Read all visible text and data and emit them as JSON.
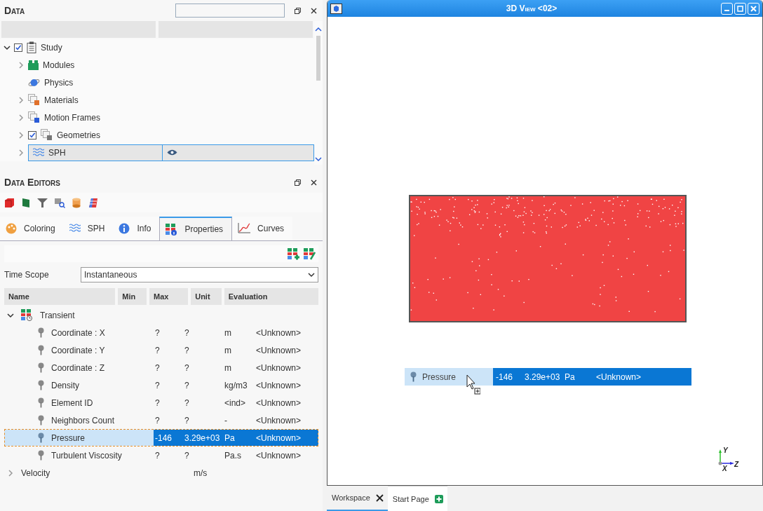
{
  "data_panel": {
    "title": "Data",
    "tree": [
      {
        "label": "Study",
        "kind": "study",
        "expanded": true,
        "checked": true,
        "selected": false,
        "children": [
          {
            "label": "Modules",
            "kind": "modules",
            "expanded": false,
            "selected": false
          },
          {
            "label": "Physics",
            "kind": "physics",
            "selected": false
          },
          {
            "label": "Materials",
            "kind": "materials",
            "expanded": false,
            "selected": false
          },
          {
            "label": "Motion Frames",
            "kind": "frames",
            "expanded": false,
            "selected": false
          },
          {
            "label": "Geometries",
            "kind": "geometries",
            "expanded": false,
            "checked": true,
            "selected": false
          },
          {
            "label": "SPH",
            "kind": "sph",
            "expanded": false,
            "selected": true,
            "visible": true
          }
        ]
      }
    ]
  },
  "editors_panel": {
    "title": "Data Editors",
    "tabs": [
      {
        "label": "Coloring",
        "kind": "coloring",
        "selected": false
      },
      {
        "label": "SPH",
        "kind": "sph",
        "selected": false
      },
      {
        "label": "Info",
        "kind": "info",
        "selected": false
      },
      {
        "label": "Properties",
        "kind": "properties",
        "selected": true
      },
      {
        "label": "Curves",
        "kind": "curves",
        "selected": false
      }
    ],
    "time_scope": {
      "label": "Time Scope",
      "value": "Instantaneous"
    },
    "table": {
      "columns": [
        "Name",
        "Min",
        "Max",
        "Unit",
        "Evaluation"
      ],
      "rows": [
        {
          "name": "Transient",
          "kind": "group",
          "expanded": true,
          "children": [
            {
              "name": "Coordinate : X",
              "min": "?",
              "max": "?",
              "unit": "m",
              "evaluation": "<Unknown>",
              "selected": false
            },
            {
              "name": "Coordinate : Y",
              "min": "?",
              "max": "?",
              "unit": "m",
              "evaluation": "<Unknown>",
              "selected": false
            },
            {
              "name": "Coordinate : Z",
              "min": "?",
              "max": "?",
              "unit": "m",
              "evaluation": "<Unknown>",
              "selected": false
            },
            {
              "name": "Density",
              "min": "?",
              "max": "?",
              "unit": "kg/m3",
              "evaluation": "<Unknown>",
              "selected": false
            },
            {
              "name": "Element ID",
              "min": "?",
              "max": "?",
              "unit": "<ind>",
              "evaluation": "<Unknown>",
              "selected": false
            },
            {
              "name": "Neighbors Count",
              "min": "?",
              "max": "?",
              "unit": "-",
              "evaluation": "<Unknown>",
              "selected": false
            },
            {
              "name": "Pressure",
              "min": "-146",
              "max": "3.29e+03",
              "unit": "Pa",
              "evaluation": "<Unknown>",
              "selected": true
            },
            {
              "name": "Turbulent Viscosity",
              "min": "?",
              "max": "?",
              "unit": "Pa.s",
              "evaluation": "<Unknown>",
              "selected": false
            }
          ]
        },
        {
          "name": "Velocity",
          "kind": "group",
          "expanded": false,
          "unit": "m/s"
        }
      ]
    }
  },
  "view_window": {
    "title": "3D View <02>",
    "drag_row": {
      "name": "Pressure",
      "min": "-146",
      "max": "3.29e+03",
      "unit": "Pa",
      "evaluation": "<Unknown>"
    },
    "axes": {
      "y": "Y",
      "x": "X",
      "z": "Z"
    }
  },
  "bottom_tabs": [
    {
      "label": "Workspace",
      "selected": true,
      "kind": "closable"
    },
    {
      "label": "Start Page",
      "selected": false,
      "kind": "add"
    }
  ]
}
